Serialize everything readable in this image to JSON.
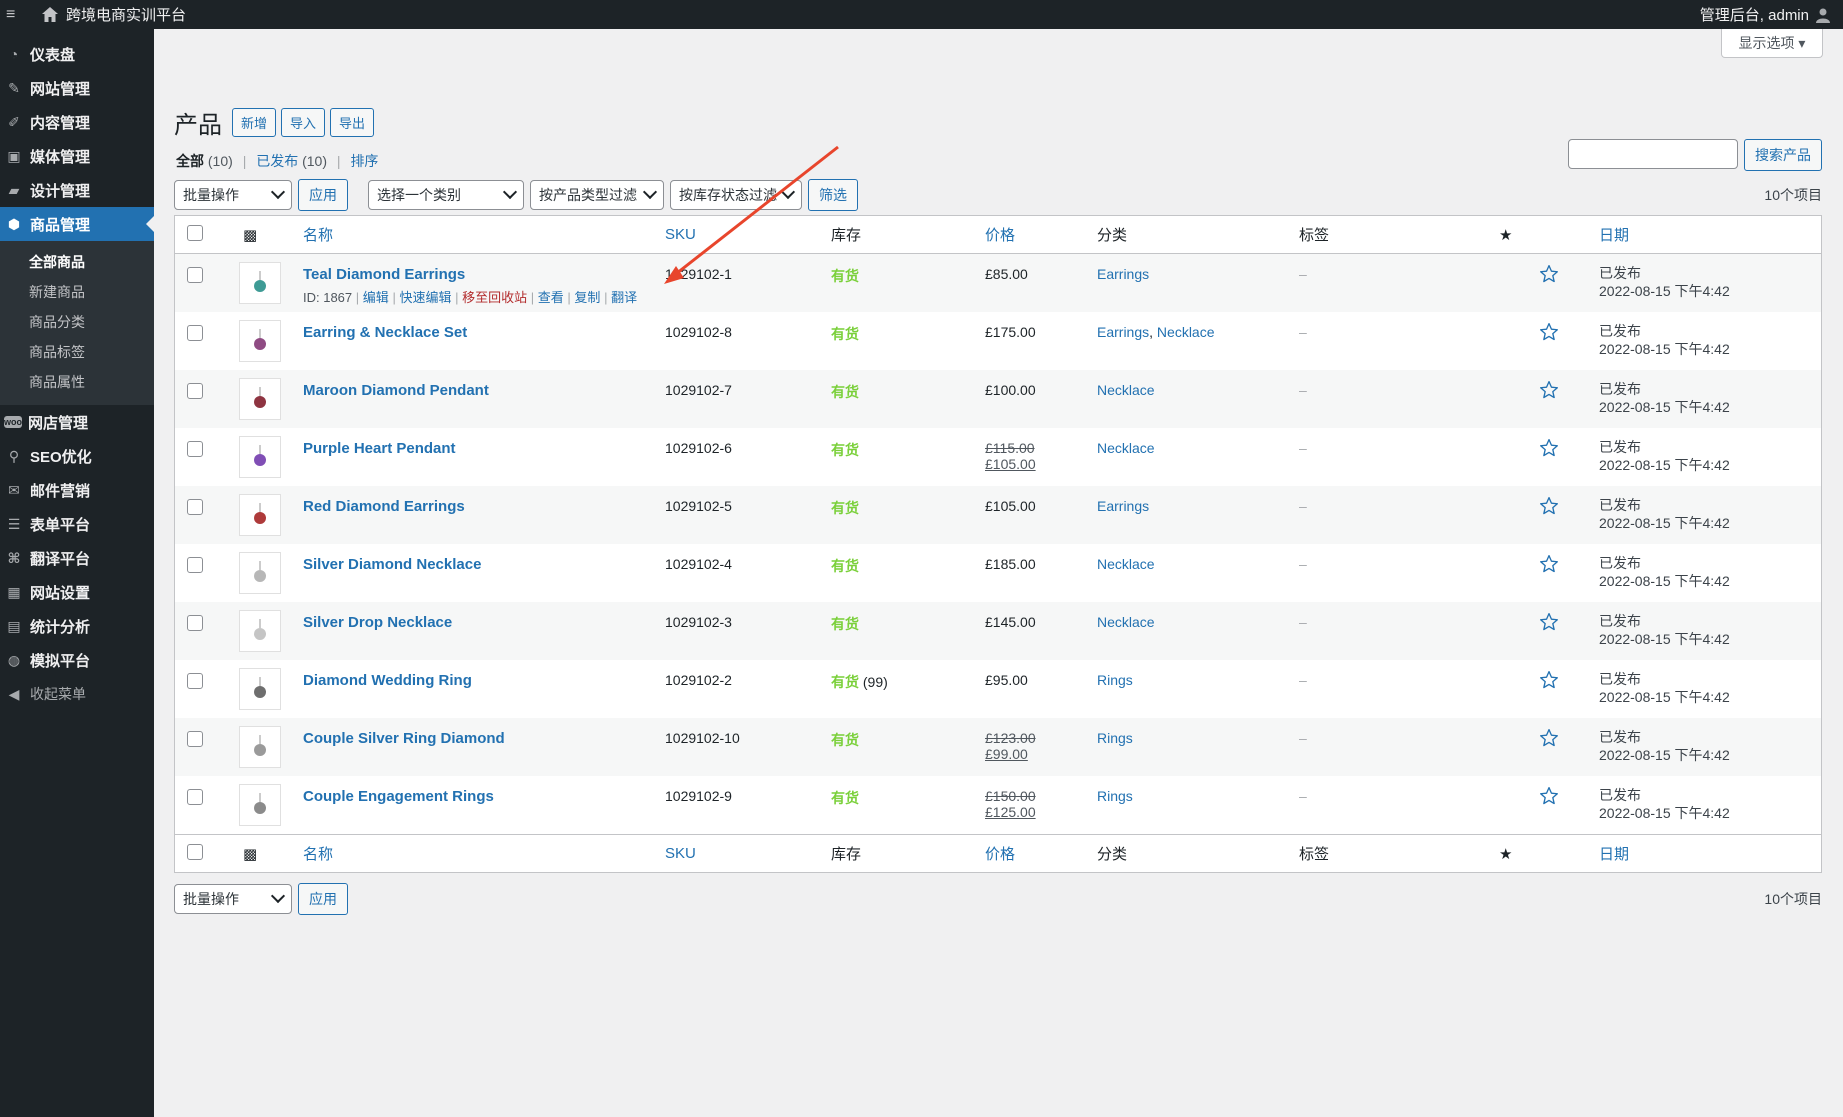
{
  "adminbar": {
    "site_title": "跨境电商实训平台",
    "user_text": "管理后台, admin"
  },
  "sidebar": {
    "items": [
      {
        "label": "仪表盘",
        "icon": "dashboard-icon"
      },
      {
        "label": "网站管理",
        "icon": "pin-icon"
      },
      {
        "label": "内容管理",
        "icon": "pencil-icon"
      },
      {
        "label": "媒体管理",
        "icon": "media-icon"
      },
      {
        "label": "设计管理",
        "icon": "folder-icon"
      },
      {
        "label": "商品管理",
        "icon": "cube-icon"
      },
      {
        "label": "网店管理",
        "icon": "woo-icon"
      },
      {
        "label": "SEO优化",
        "icon": "search-icon"
      },
      {
        "label": "邮件营销",
        "icon": "mail-icon"
      },
      {
        "label": "表单平台",
        "icon": "form-icon"
      },
      {
        "label": "翻译平台",
        "icon": "translate-icon"
      },
      {
        "label": "网站设置",
        "icon": "settings-icon"
      },
      {
        "label": "统计分析",
        "icon": "stats-icon"
      },
      {
        "label": "模拟平台",
        "icon": "globe-icon"
      }
    ],
    "submenu": [
      "全部商品",
      "新建商品",
      "商品分类",
      "商品标签",
      "商品属性"
    ],
    "collapse_label": "收起菜单"
  },
  "screen_options": "显示选项 ▾",
  "page": {
    "title": "产品",
    "buttons": [
      "新增",
      "导入",
      "导出"
    ]
  },
  "views": {
    "all_label": "全部",
    "all_count": "(10)",
    "published_label": "已发布",
    "published_count": "(10)",
    "sort_label": "排序"
  },
  "search": {
    "button": "搜索产品"
  },
  "filters": {
    "bulk": "批量操作",
    "apply": "应用",
    "category": "选择一个类别",
    "type": "按产品类型过滤",
    "stock": "按库存状态过滤",
    "filter": "筛选",
    "count": "10个项目"
  },
  "columns": {
    "name": "名称",
    "sku": "SKU",
    "stock": "库存",
    "price": "价格",
    "category": "分类",
    "tags": "标签",
    "date": "日期"
  },
  "row_actions": {
    "id": "ID: 1867",
    "edit": "编辑",
    "quick_edit": "快速编辑",
    "trash": "移至回收站",
    "view": "查看",
    "copy": "复制",
    "translate": "翻译"
  },
  "products": [
    {
      "name": "Teal Diamond Earrings",
      "sku": "1029102-1",
      "stock": "有货",
      "stock_qty": "",
      "price": "£85.00",
      "price_old": "",
      "category": "Earrings",
      "tags": "–",
      "status": "已发布",
      "date": "2022-08-15 下午4:42"
    },
    {
      "name": "Earring & Necklace Set",
      "sku": "1029102-8",
      "stock": "有货",
      "stock_qty": "",
      "price": "£175.00",
      "price_old": "",
      "category": "Earrings, Necklace",
      "tags": "–",
      "status": "已发布",
      "date": "2022-08-15 下午4:42"
    },
    {
      "name": "Maroon Diamond Pendant",
      "sku": "1029102-7",
      "stock": "有货",
      "stock_qty": "",
      "price": "£100.00",
      "price_old": "",
      "category": "Necklace",
      "tags": "–",
      "status": "已发布",
      "date": "2022-08-15 下午4:42"
    },
    {
      "name": "Purple Heart Pendant",
      "sku": "1029102-6",
      "stock": "有货",
      "stock_qty": "",
      "price": "£105.00",
      "price_old": "£115.00",
      "category": "Necklace",
      "tags": "–",
      "status": "已发布",
      "date": "2022-08-15 下午4:42"
    },
    {
      "name": "Red Diamond Earrings",
      "sku": "1029102-5",
      "stock": "有货",
      "stock_qty": "",
      "price": "£105.00",
      "price_old": "",
      "category": "Earrings",
      "tags": "–",
      "status": "已发布",
      "date": "2022-08-15 下午4:42"
    },
    {
      "name": "Silver Diamond Necklace",
      "sku": "1029102-4",
      "stock": "有货",
      "stock_qty": "",
      "price": "£185.00",
      "price_old": "",
      "category": "Necklace",
      "tags": "–",
      "status": "已发布",
      "date": "2022-08-15 下午4:42"
    },
    {
      "name": "Silver Drop Necklace",
      "sku": "1029102-3",
      "stock": "有货",
      "stock_qty": "",
      "price": "£145.00",
      "price_old": "",
      "category": "Necklace",
      "tags": "–",
      "status": "已发布",
      "date": "2022-08-15 下午4:42"
    },
    {
      "name": "Diamond Wedding Ring",
      "sku": "1029102-2",
      "stock": "有货",
      "stock_qty": "(99)",
      "price": "£95.00",
      "price_old": "",
      "category": "Rings",
      "tags": "–",
      "status": "已发布",
      "date": "2022-08-15 下午4:42"
    },
    {
      "name": "Couple Silver Ring Diamond",
      "sku": "1029102-10",
      "stock": "有货",
      "stock_qty": "",
      "price": "£99.00",
      "price_old": "£123.00",
      "category": "Rings",
      "tags": "–",
      "status": "已发布",
      "date": "2022-08-15 下午4:42"
    },
    {
      "name": "Couple Engagement Rings",
      "sku": "1029102-9",
      "stock": "有货",
      "stock_qty": "",
      "price": "£125.00",
      "price_old": "£150.00",
      "category": "Rings",
      "tags": "–",
      "status": "已发布",
      "date": "2022-08-15 下午4:42"
    }
  ],
  "colors": {
    "sidebar_bg": "#1d2327",
    "accent": "#2271b1",
    "in_stock": "#7ad03a",
    "trash": "#b32d2e",
    "annotation_arrow": "#e8452c"
  }
}
